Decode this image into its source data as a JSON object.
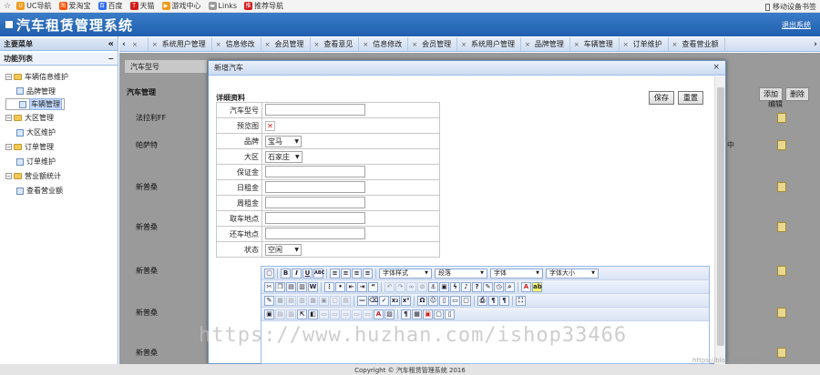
{
  "browser": {
    "bookmarks": [
      {
        "label": "UC导航",
        "icon": "uc-icon",
        "color": "#f29a1c"
      },
      {
        "label": "爱淘宝",
        "icon": "taobao-icon",
        "color": "#ff5000"
      },
      {
        "label": "百度",
        "icon": "baidu-icon",
        "color": "#2f6ef0"
      },
      {
        "label": "天猫",
        "icon": "tmall-icon",
        "color": "#d21d1d"
      },
      {
        "label": "游戏中心",
        "icon": "game-icon",
        "color": "#f29a1c"
      },
      {
        "label": "Links",
        "icon": "folder-icon",
        "color": "#999999"
      },
      {
        "label": "推荐导航",
        "icon": "recommend-icon",
        "color": "#d21d1d"
      }
    ],
    "mobile_bookmarks": "移动设备书签"
  },
  "app": {
    "title": "汽车租赁管理系统",
    "logout": "退出系统",
    "footer": "Copyright © 汽车租赁管理系统 2016"
  },
  "sidebar": {
    "header": "主要菜单",
    "collapse": "«",
    "list_header": "功能列表",
    "list_toggle": "−",
    "tree": [
      {
        "label": "车辆信息维护",
        "children": [
          "品牌管理",
          "车辆管理"
        ]
      },
      {
        "label": "大区管理",
        "children": [
          "大区维护"
        ]
      },
      {
        "label": "订单管理",
        "children": [
          "订单维护"
        ]
      },
      {
        "label": "营业额统计",
        "children": [
          "查看营业额"
        ]
      }
    ]
  },
  "tabs": [
    "系统用户管理",
    "信息修改",
    "会员管理",
    "查看意见",
    "信息修改",
    "会员管理",
    "系统用户管理",
    "品牌管理",
    "车辆管理",
    "订单维护",
    "查看营业额"
  ],
  "background": {
    "search_label": "汽车型号",
    "list_title": "汽车管理",
    "add": "添加",
    "delete": "删除",
    "edit_col": "编辑",
    "rows": [
      "法拉利FF",
      "帕萨特",
      "新普桑",
      "新普桑",
      "新普桑",
      "新普桑",
      "新普桑"
    ],
    "status_partial": "中"
  },
  "dialog": {
    "title": "新增汽车",
    "close": "×",
    "section": "详细资料",
    "save": "保存",
    "reset": "重置",
    "fields": {
      "model": "汽车型号",
      "preview": "预览图",
      "brand": "品牌",
      "brand_value": "宝马",
      "region": "大区",
      "region_value": "石家庄",
      "deposit": "保证金",
      "daily_rent": "日租金",
      "weekly_rent": "周租金",
      "pickup": "取车地点",
      "return": "还车地点",
      "status": "状态",
      "status_value": "空闲"
    }
  },
  "editor": {
    "font_style": "字体样式",
    "paragraph": "段落",
    "font": "字体",
    "font_size": "字体大小"
  },
  "watermark": "https://www.huzhan.com/ishop33466",
  "watermark_small": "https://blog.csdn.net/..."
}
